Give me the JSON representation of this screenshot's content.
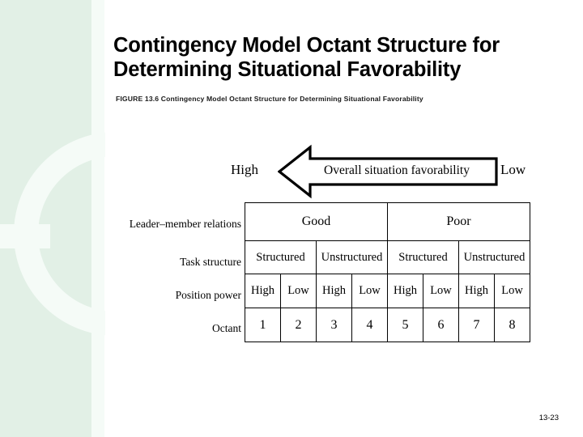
{
  "slide": {
    "title": "Contingency Model Octant Structure for Determining Situational Favorability",
    "figure_caption": "FIGURE 13.6  Contingency Model Octant Structure for Determining Situational Favorability",
    "page_number": "13-23"
  },
  "arrow": {
    "left_label": "High",
    "right_label": "Low",
    "body_label": "Overall situation favorability",
    "direction": "left",
    "stroke_color": "#000000",
    "fill_color": "#ffffff"
  },
  "table": {
    "row_labels": [
      "Leader–member relations",
      "Task structure",
      "Position power",
      "Octant"
    ],
    "relations": [
      "Good",
      "Poor"
    ],
    "task_structure": [
      "Structured",
      "Unstructured",
      "Structured",
      "Unstructured"
    ],
    "position_power": [
      "High",
      "Low",
      "High",
      "Low",
      "High",
      "Low",
      "High",
      "Low"
    ],
    "octant": [
      "1",
      "2",
      "3",
      "4",
      "5",
      "6",
      "7",
      "8"
    ]
  },
  "decoration": {
    "band_color": "#e2f0e6",
    "ring_color": "#f5fbf7"
  }
}
